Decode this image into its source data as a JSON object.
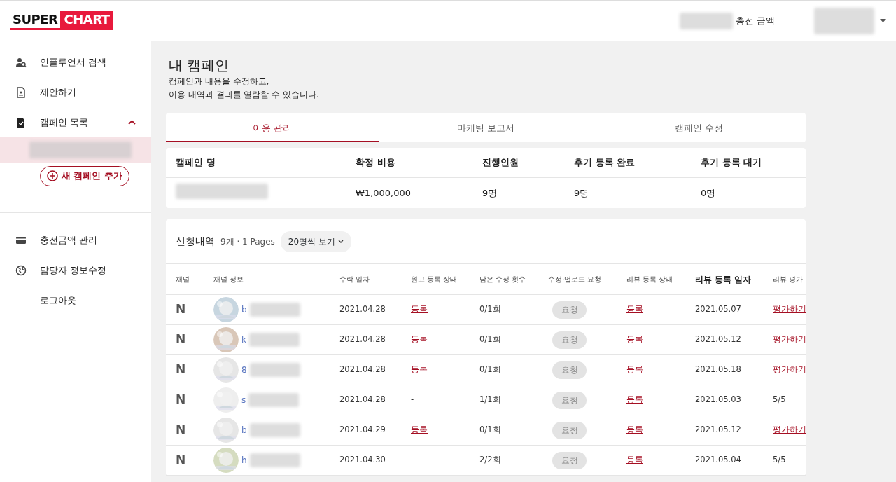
{
  "header": {
    "logo": [
      "SUPER",
      "CHART"
    ],
    "balance_label": "충전 금액"
  },
  "sidebar": {
    "items": [
      {
        "label": "인플루언서 검색"
      },
      {
        "label": "제안하기"
      },
      {
        "label": "캠페인 목록",
        "expanded": true
      }
    ],
    "add_button": "새 캠페인 추가",
    "items2": [
      {
        "label": "충전금액 관리"
      },
      {
        "label": "담당자 정보수정"
      },
      {
        "label": "로그아웃"
      }
    ]
  },
  "page": {
    "title": "내 캠페인",
    "subtitle": [
      "캠페인과 내용을 수정하고,",
      "이용 내역과 결과를 열람할 수 있습니다."
    ]
  },
  "tabs": [
    {
      "label": "이용 관리",
      "selected": true
    },
    {
      "label": "마케팅 보고서",
      "selected": false
    },
    {
      "label": "캠페인 수정",
      "selected": false
    }
  ],
  "summary": {
    "columns": [
      "캠페인 명",
      "확정 비용",
      "진행인원",
      "후기 등록 완료",
      "후기 등록 대기"
    ],
    "values": [
      "₩1,000,000",
      "9명",
      "9명",
      "0명"
    ]
  },
  "applications": {
    "title": "신청내역",
    "count": "9개 · 1 Pages",
    "page_size": "20명씩 보기",
    "columns": [
      {
        "label": "채널",
        "bold": false
      },
      {
        "label": "채널 정보",
        "bold": false
      },
      {
        "label": "수락 일자",
        "bold": false
      },
      {
        "label": "원고 등록 상태",
        "bold": false
      },
      {
        "label": "남은 수정 횟수",
        "bold": false
      },
      {
        "label": "수정·업로드 요청",
        "bold": false
      },
      {
        "label": "리뷰 등록 상태",
        "bold": false
      },
      {
        "label": "리뷰 등록 일자",
        "bold": true
      },
      {
        "label": "리뷰 평가",
        "bold": false
      }
    ],
    "rows": [
      {
        "channel": "N",
        "initial": "b",
        "accepted": "2021.04.28",
        "draft": {
          "text": "등록",
          "kind": "link"
        },
        "remaining": "0/1회",
        "request": "요청",
        "review_status": "등록",
        "review_date": "2021.05.07",
        "rating": {
          "text": "평가하기",
          "kind": "link"
        }
      },
      {
        "channel": "N",
        "initial": "k",
        "accepted": "2021.04.28",
        "draft": {
          "text": "등록",
          "kind": "link"
        },
        "remaining": "0/1회",
        "request": "요청",
        "review_status": "등록",
        "review_date": "2021.05.12",
        "rating": {
          "text": "평가하기",
          "kind": "link"
        }
      },
      {
        "channel": "N",
        "initial": "8",
        "accepted": "2021.04.28",
        "draft": {
          "text": "등록",
          "kind": "link"
        },
        "remaining": "0/1회",
        "request": "요청",
        "review_status": "등록",
        "review_date": "2021.05.18",
        "rating": {
          "text": "평가하기",
          "kind": "link"
        }
      },
      {
        "channel": "N",
        "initial": "s",
        "accepted": "2021.04.28",
        "draft": {
          "text": "-",
          "kind": "text"
        },
        "remaining": "1/1회",
        "request": "요청",
        "review_status": "등록",
        "review_date": "2021.05.03",
        "rating": {
          "text": "5/5",
          "kind": "text"
        }
      },
      {
        "channel": "N",
        "initial": "b",
        "accepted": "2021.04.29",
        "draft": {
          "text": "등록",
          "kind": "link"
        },
        "remaining": "0/1회",
        "request": "요청",
        "review_status": "등록",
        "review_date": "2021.05.12",
        "rating": {
          "text": "평가하기",
          "kind": "link"
        }
      },
      {
        "channel": "N",
        "initial": "h",
        "accepted": "2021.04.30",
        "draft": {
          "text": "-",
          "kind": "text"
        },
        "remaining": "2/2회",
        "request": "요청",
        "review_status": "등록",
        "review_date": "2021.05.04",
        "rating": {
          "text": "5/5",
          "kind": "text"
        }
      }
    ]
  }
}
